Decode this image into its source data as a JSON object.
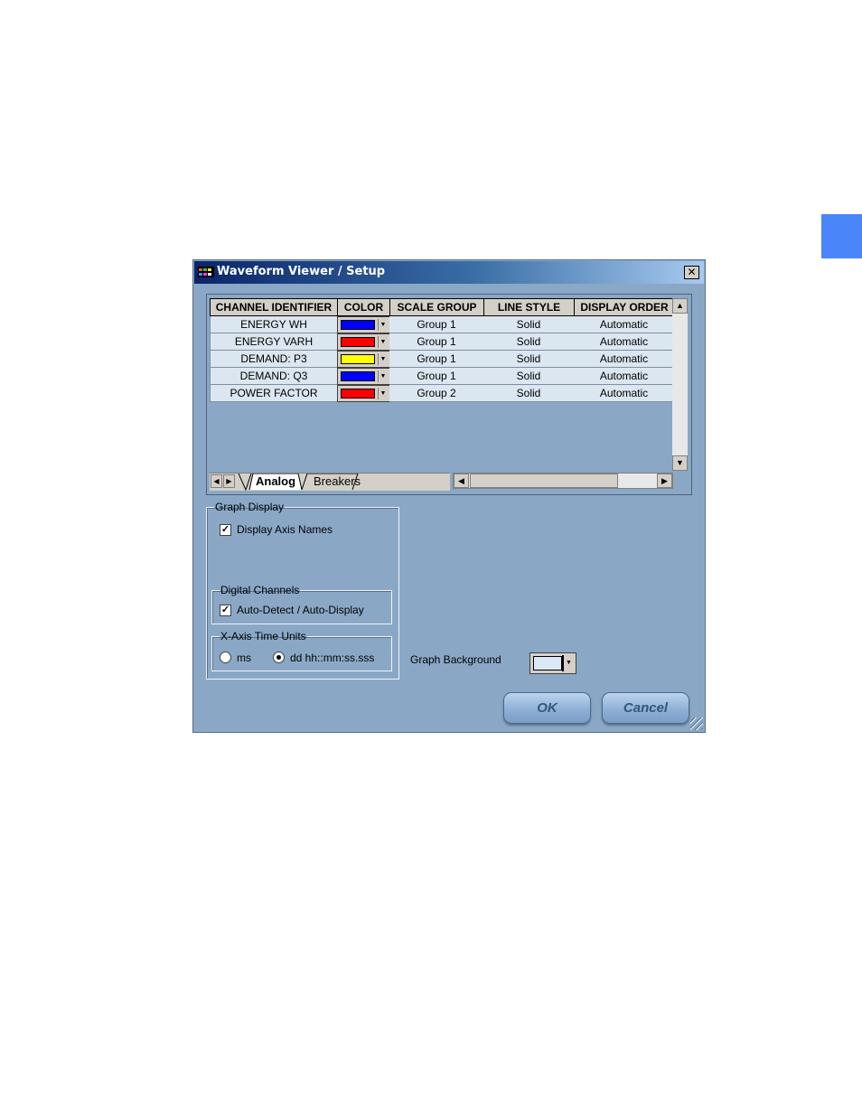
{
  "window": {
    "title": "Waveform Viewer / Setup",
    "close_glyph": "✕"
  },
  "grid": {
    "columns": [
      "CHANNEL IDENTIFIER",
      "COLOR",
      "SCALE GROUP",
      "LINE STYLE",
      "DISPLAY ORDER"
    ],
    "rows": [
      {
        "channel": "ENERGY WH",
        "color": "#0000ff",
        "scale_group": "Group 1",
        "line_style": "Solid",
        "display_order": "Automatic"
      },
      {
        "channel": "ENERGY VARH",
        "color": "#ff0000",
        "scale_group": "Group 1",
        "line_style": "Solid",
        "display_order": "Automatic"
      },
      {
        "channel": "DEMAND: P3",
        "color": "#ffff00",
        "scale_group": "Group 1",
        "line_style": "Solid",
        "display_order": "Automatic"
      },
      {
        "channel": "DEMAND: Q3",
        "color": "#0000ff",
        "scale_group": "Group 1",
        "line_style": "Solid",
        "display_order": "Automatic"
      },
      {
        "channel": "POWER FACTOR",
        "color": "#ff0000",
        "scale_group": "Group 2",
        "line_style": "Solid",
        "display_order": "Automatic"
      }
    ],
    "sheet_tabs": [
      "Analog",
      "Breakers"
    ],
    "active_tab": "Analog"
  },
  "graph_display": {
    "legend": "Graph Display",
    "display_axis_names_label": "Display Axis Names",
    "display_axis_names_checked": true
  },
  "digital_channels": {
    "legend": "Digital Channels",
    "auto_detect_label": "Auto-Detect / Auto-Display",
    "auto_detect_checked": true
  },
  "x_axis_time_units": {
    "legend": "X-Axis Time Units",
    "options": [
      "ms",
      "dd hh::mm:ss.sss"
    ],
    "selected": "dd hh::mm:ss.sss"
  },
  "graph_background": {
    "label": "Graph Background",
    "color": "#dbe9f7"
  },
  "buttons": {
    "ok": "OK",
    "cancel": "Cancel"
  },
  "colors": {
    "dialog_bg": "#8aa8c6",
    "cell_bg": "#dbe6f0",
    "accent_tab": "#4a86f7"
  }
}
